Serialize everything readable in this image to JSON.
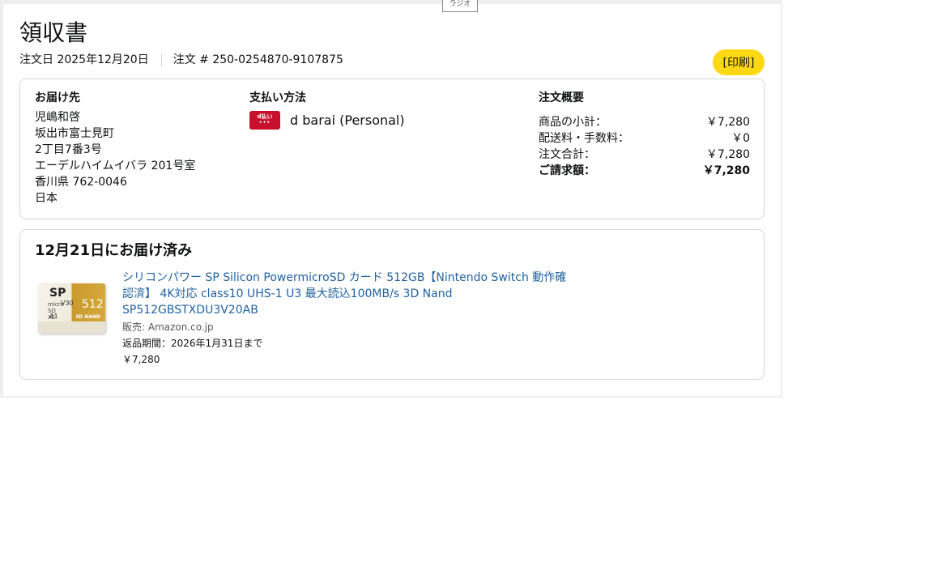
{
  "tooltip": {
    "text": "ラジオ"
  },
  "header": {
    "title": "領収書",
    "order_date_label": "注文日 2025年12月20日",
    "order_number_label": "注文 # 250-0254870-9107875",
    "print_label": "[印刷]"
  },
  "shipping_address": {
    "heading": "お届け先",
    "lines": [
      "児嶋和啓",
      "坂出市富士見町",
      "2丁目7番3号",
      "エーデルハイムイバラ 201号室",
      "香川県 762-0046",
      "日本"
    ]
  },
  "payment": {
    "heading": "支払い方法",
    "icon_label": "d払い",
    "icon": "d-barai-logo-icon",
    "method": "d barai (Personal)"
  },
  "order_summary": {
    "heading": "注文概要",
    "rows": [
      {
        "label": "商品の小計：",
        "value": "￥7,280"
      },
      {
        "label": "配送料・手数料：",
        "value": "￥0"
      },
      {
        "label": "注文合計：",
        "value": "￥7,280"
      },
      {
        "label": "ご請求額：",
        "value": "￥7,280"
      }
    ]
  },
  "shipment": {
    "status": "12月21日にお届け済み",
    "item": {
      "image_text": {
        "brand": "SP",
        "micro": "micro SD XC",
        "speed": "V30",
        "app": "A1",
        "capacity": "512",
        "nand": "3D NAND"
      },
      "title": "シリコンパワー SP Silicon PowermicroSD カード 512GB【Nintendo Switch 動作確認済】 4K対応 class10 UHS-1 U3 最大読込100MB/s 3D Nand SP512GBSTXDU3V20AB",
      "seller": "販売: Amazon.co.jp",
      "return_window": "返品期間：2026年1月31日まで",
      "price": "￥7,280"
    }
  },
  "colors": {
    "print_button": "#ffd814",
    "link": "#2162a1",
    "border": "#d5d9d9",
    "d_barai_red": "#c8102e"
  }
}
